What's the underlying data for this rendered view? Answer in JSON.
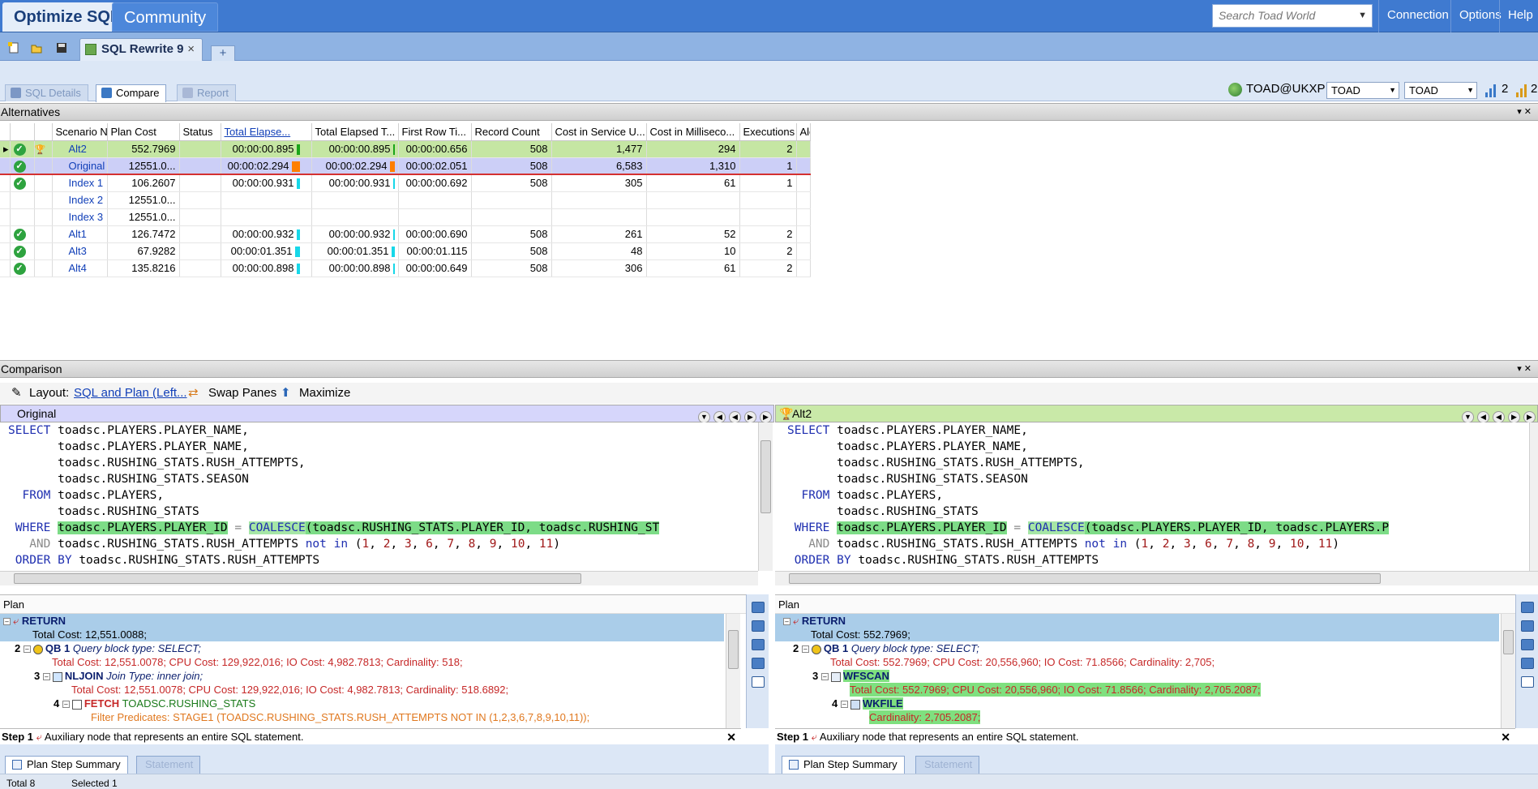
{
  "header": {
    "tabs": [
      {
        "label": "Optimize SQL"
      },
      {
        "label": "Community"
      }
    ],
    "search_placeholder": "Search Toad World",
    "links": [
      "Connection",
      "Options",
      "Help"
    ]
  },
  "docbar": {
    "tab_label": "SQL Rewrite 9",
    "close": "×",
    "add": "+"
  },
  "subtabs": [
    "SQL Details",
    "Compare",
    "Report"
  ],
  "connection": {
    "name": "TOAD@UKXP",
    "combo1": "TOAD",
    "combo2": "TOAD",
    "count1": "2",
    "count2": "2"
  },
  "alternatives": {
    "title": "Alternatives",
    "columns": [
      "Scenario Na...",
      "Plan Cost",
      "Status",
      "Total Elapse...",
      "Total Elapsed T...",
      "First Row Ti...",
      "Record Count",
      "Cost in Service U...",
      "Cost in Milliseco...",
      "Executions",
      "Alert"
    ],
    "rows": [
      {
        "name": "Alt2",
        "ok": true,
        "winner": true,
        "plan_cost": "552.7969",
        "status": "",
        "total_elapsed": "00:00:00.895",
        "total_elapsed_t": "00:00:00.895",
        "first_row": "00:00:00.656",
        "record_count": "508",
        "cost_service": "1,477",
        "cost_ms": "294",
        "executions": "2",
        "bar_color": "#1aa51a",
        "bar_fraction": 0.39
      },
      {
        "name": "Original",
        "ok": true,
        "winner": false,
        "plan_cost": "12551.0...",
        "status": "",
        "total_elapsed": "00:00:02.294",
        "total_elapsed_t": "00:00:02.294",
        "first_row": "00:00:02.051",
        "record_count": "508",
        "cost_service": "6,583",
        "cost_ms": "1,310",
        "executions": "1",
        "bar_color": "#ff7f00",
        "bar_fraction": 1.0
      },
      {
        "name": "Index 1",
        "ok": true,
        "winner": false,
        "plan_cost": "106.2607",
        "status": "",
        "total_elapsed": "00:00:00.931",
        "total_elapsed_t": "00:00:00.931",
        "first_row": "00:00:00.692",
        "record_count": "508",
        "cost_service": "305",
        "cost_ms": "61",
        "executions": "1",
        "bar_color": "#17d7e8",
        "bar_fraction": 0.41
      },
      {
        "name": "Index 2",
        "ok": false,
        "winner": false,
        "plan_cost": "12551.0...",
        "status": "",
        "total_elapsed": "",
        "total_elapsed_t": "",
        "first_row": "",
        "record_count": "",
        "cost_service": "",
        "cost_ms": "",
        "executions": "",
        "bar_color": "",
        "bar_fraction": 0
      },
      {
        "name": "Index 3",
        "ok": false,
        "winner": false,
        "plan_cost": "12551.0...",
        "status": "",
        "total_elapsed": "",
        "total_elapsed_t": "",
        "first_row": "",
        "record_count": "",
        "cost_service": "",
        "cost_ms": "",
        "executions": "",
        "bar_color": "",
        "bar_fraction": 0
      },
      {
        "name": "Alt1",
        "ok": true,
        "winner": false,
        "plan_cost": "126.7472",
        "status": "",
        "total_elapsed": "00:00:00.932",
        "total_elapsed_t": "00:00:00.932",
        "first_row": "00:00:00.690",
        "record_count": "508",
        "cost_service": "261",
        "cost_ms": "52",
        "executions": "2",
        "bar_color": "#17d7e8",
        "bar_fraction": 0.41
      },
      {
        "name": "Alt3",
        "ok": true,
        "winner": false,
        "plan_cost": "67.9282",
        "status": "",
        "total_elapsed": "00:00:01.351",
        "total_elapsed_t": "00:00:01.351",
        "first_row": "00:00:01.115",
        "record_count": "508",
        "cost_service": "48",
        "cost_ms": "10",
        "executions": "2",
        "bar_color": "#17d7e8",
        "bar_fraction": 0.59
      },
      {
        "name": "Alt4",
        "ok": true,
        "winner": false,
        "plan_cost": "135.8216",
        "status": "",
        "total_elapsed": "00:00:00.898",
        "total_elapsed_t": "00:00:00.898",
        "first_row": "00:00:00.649",
        "record_count": "508",
        "cost_service": "306",
        "cost_ms": "61",
        "executions": "2",
        "bar_color": "#17d7e8",
        "bar_fraction": 0.39
      }
    ]
  },
  "comparison": {
    "title": "Comparison",
    "layout_label": "Layout:",
    "layout_value": "SQL and Plan (Left...",
    "swap": "Swap Panes",
    "maximize": "Maximize",
    "left_title": "Original",
    "right_title": "Alt2",
    "plan_label": "Plan",
    "step_label": "Step 1",
    "step_desc": "Auxiliary node that represents an entire SQL statement.",
    "bottom_tabs": [
      "Plan Step Summary",
      "Statement"
    ]
  },
  "sql_left": {
    "select": "SELECT",
    "lines": [
      "toadsc.PLAYERS.PLAYER_NAME,",
      "toadsc.PLAYERS.PLAYER_NAME,",
      "toadsc.RUSHING_STATS.RUSH_ATTEMPTS,",
      "toadsc.RUSHING_STATS.SEASON"
    ],
    "from": "FROM",
    "from_lines": [
      "toadsc.PLAYERS,",
      "toadsc.RUSHING_STATS"
    ],
    "where": "WHERE",
    "where_lhs": "toadsc.PLAYERS.PLAYER_ID",
    "eq": "=",
    "coalesce": "COALESCE",
    "where_rhs": "(toadsc.RUSHING_STATS.PLAYER_ID, toadsc.RUSHING_ST",
    "and": "AND",
    "and_expr": "toadsc.RUSHING_STATS.RUSH_ATTEMPTS",
    "not_in": "not in",
    "in_list": [
      "1",
      "2",
      "3",
      "6",
      "7",
      "8",
      "9",
      "10",
      "11"
    ],
    "order": "ORDER BY",
    "order_expr": "toadsc.RUSHING_STATS.RUSH_ATTEMPTS"
  },
  "sql_right": {
    "where_rhs": "(toadsc.PLAYERS.PLAYER_ID, toadsc.PLAYERS.P"
  },
  "plan_left": {
    "return": "RETURN",
    "total_cost": "Total Cost: 12,551.0088;",
    "qb": "QB 1",
    "qb_type": "Query block type: SELECT;",
    "qb_cost": "Total Cost: 12,551.0078; CPU Cost: 129,922,016; IO Cost: 4,982.7813; Cardinality: 518;",
    "nljoin": "NLJOIN",
    "join_type": "Join Type: inner join;",
    "nl_cost": "Total Cost: 12,551.0078; CPU Cost: 129,922,016; IO Cost: 4,982.7813; Cardinality: 518.6892;",
    "fetch": "FETCH",
    "fetch_table": "TOADSC.RUSHING_STATS",
    "filter": "Filter Predicates: STAGE1 (TOADSC.RUSHING_STATS.RUSH_ATTEMPTS NOT IN (1,2,3,6,7,8,9,10,11));"
  },
  "plan_right": {
    "return": "RETURN",
    "total_cost": "Total Cost: 552.7969;",
    "qb": "QB 1",
    "qb_type": "Query block type: SELECT;",
    "qb_cost": "Total Cost: 552.7969; CPU Cost: 20,556,960; IO Cost: 71.8566; Cardinality: 2,705;",
    "wfscan": "WFSCAN",
    "wf_cost": "Total Cost: 552.7969; CPU Cost: 20,556,960; IO Cost: 71.8566; Cardinality: 2,705.2087;",
    "wkfile": "WKFILE",
    "wk_card": "Cardinality: 2,705.2087;"
  },
  "step_numbers": [
    "2",
    "3",
    "4"
  ],
  "status": {
    "total": "Total 8",
    "selected": "Selected 1"
  }
}
